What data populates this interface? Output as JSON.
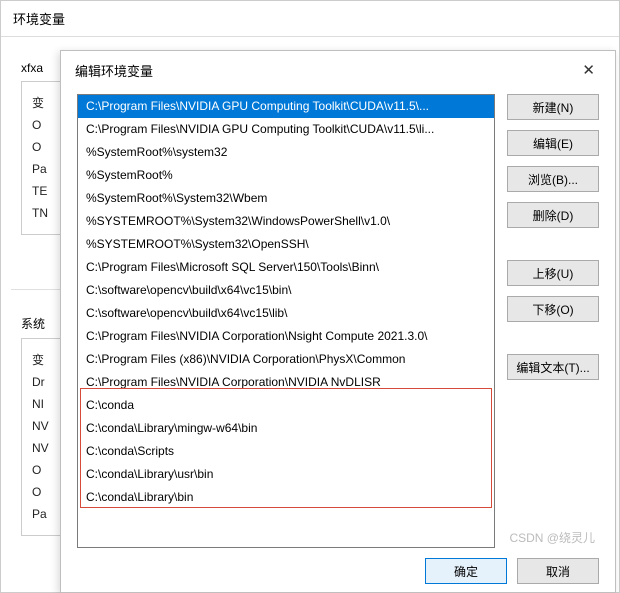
{
  "parent": {
    "title": "环境变量",
    "user_section_label": "xfxa",
    "user_vars_heading": "变",
    "user_vars": [
      "O",
      "O",
      "Pa",
      "TE",
      "TN"
    ],
    "sys_section_label": "系统",
    "sys_vars_heading": "变",
    "sys_vars": [
      "Dr",
      "NI",
      "NV",
      "NV",
      "O",
      "O",
      "Pa"
    ]
  },
  "modal": {
    "title": "编辑环境变量",
    "items": [
      "C:\\Program Files\\NVIDIA GPU Computing Toolkit\\CUDA\\v11.5\\...",
      "C:\\Program Files\\NVIDIA GPU Computing Toolkit\\CUDA\\v11.5\\li...",
      "%SystemRoot%\\system32",
      "%SystemRoot%",
      "%SystemRoot%\\System32\\Wbem",
      "%SYSTEMROOT%\\System32\\WindowsPowerShell\\v1.0\\",
      "%SYSTEMROOT%\\System32\\OpenSSH\\",
      "C:\\Program Files\\Microsoft SQL Server\\150\\Tools\\Binn\\",
      "C:\\software\\opencv\\build\\x64\\vc15\\bin\\",
      "C:\\software\\opencv\\build\\x64\\vc15\\lib\\",
      "C:\\Program Files\\NVIDIA Corporation\\Nsight Compute 2021.3.0\\",
      "C:\\Program Files (x86)\\NVIDIA Corporation\\PhysX\\Common",
      "C:\\Program Files\\NVIDIA Corporation\\NVIDIA NvDLISR",
      "C:\\conda",
      "C:\\conda\\Library\\mingw-w64\\bin",
      "C:\\conda\\Scripts",
      "C:\\conda\\Library\\usr\\bin",
      "C:\\conda\\Library\\bin"
    ],
    "selected_index": 0,
    "buttons": {
      "new": "新建(N)",
      "edit": "编辑(E)",
      "browse": "浏览(B)...",
      "delete": "删除(D)",
      "move_up": "上移(U)",
      "move_down": "下移(O)",
      "edit_text": "编辑文本(T)..."
    },
    "footer": {
      "ok": "确定",
      "cancel": "取消"
    }
  },
  "watermark": "CSDN @绕灵儿"
}
